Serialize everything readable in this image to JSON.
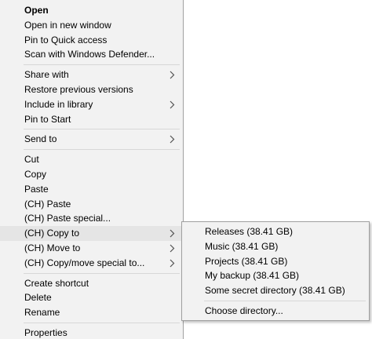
{
  "context_menu": {
    "groups": [
      [
        "Open",
        "Open in new window",
        "Pin to Quick access",
        "Scan with Windows Defender..."
      ],
      [
        "Share with",
        "Restore previous versions",
        "Include in library",
        "Pin to Start"
      ],
      [
        "Send to"
      ],
      [
        "Cut",
        "Copy",
        "Paste",
        "(CH) Paste",
        "(CH) Paste special...",
        "(CH) Copy to",
        "(CH) Move to",
        "(CH) Copy/move special to..."
      ],
      [
        "Create shortcut",
        "Delete",
        "Rename"
      ],
      [
        "Properties"
      ]
    ],
    "submenu_arrow_items": [
      "Share with",
      "Include in library",
      "Send to",
      "(CH) Copy to",
      "(CH) Move to",
      "(CH) Copy/move special to..."
    ],
    "highlighted_item": "(CH) Copy to",
    "default_item": "Open"
  },
  "copy_to_submenu": {
    "groups": [
      [
        "Releases (38.41 GB)",
        "Music (38.41 GB)",
        "Projects (38.41 GB)",
        "My backup (38.41 GB)",
        "Some secret directory (38.41 GB)"
      ],
      [
        "Choose directory..."
      ]
    ]
  },
  "icons": {
    "submenu_arrow": "chevron-right-icon"
  },
  "colors": {
    "menu_background": "#f2f2f2",
    "menu_border": "#a0a0a0",
    "separator": "#d7d7d7",
    "hover_background": "#e5e5e5",
    "arrow": "#505050"
  }
}
